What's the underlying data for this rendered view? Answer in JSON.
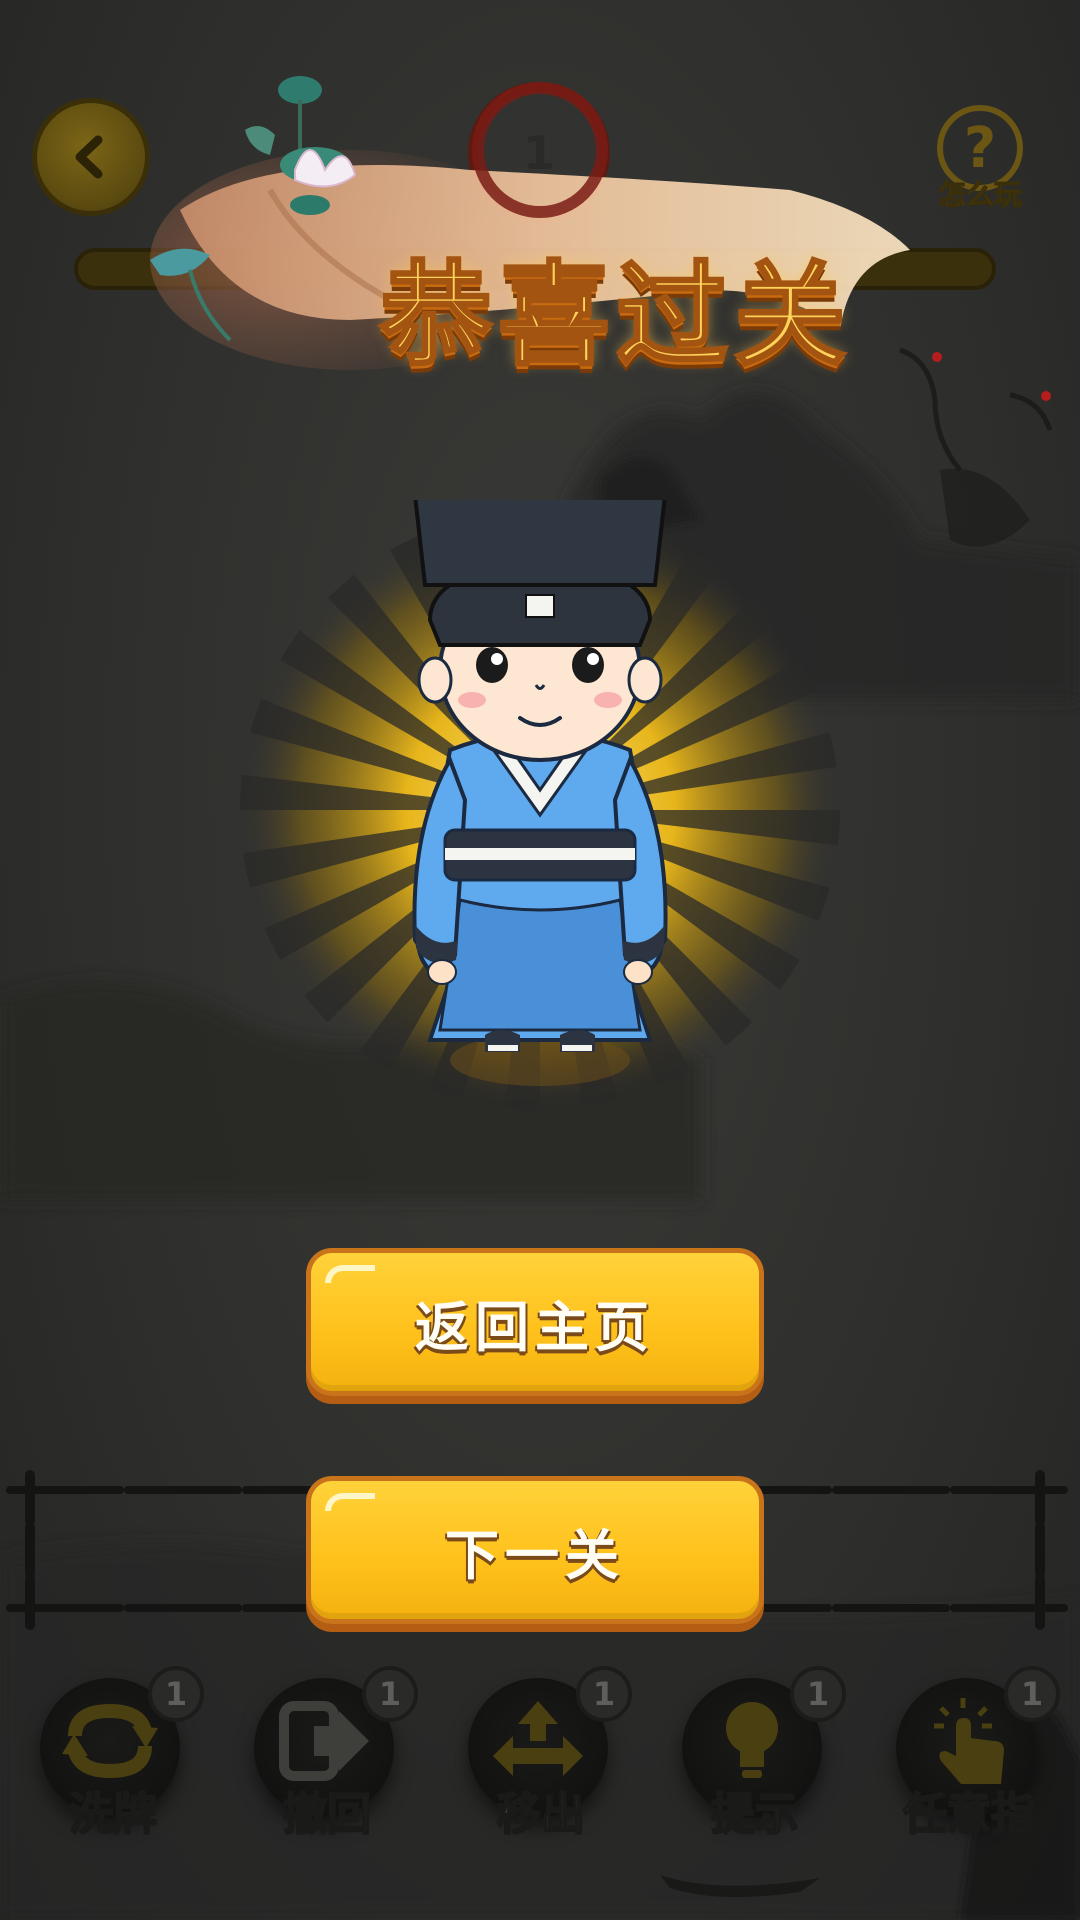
{
  "header": {
    "level_number": "1",
    "help_label": "怎么玩"
  },
  "banner": {
    "title": "恭喜过关"
  },
  "actions": {
    "home_label": "返回主页",
    "next_label": "下一关"
  },
  "tools": [
    {
      "label": "洗牌",
      "count": "1",
      "icon": "shuffle-icon"
    },
    {
      "label": "撤回",
      "count": "1",
      "icon": "undo-icon"
    },
    {
      "label": "移出",
      "count": "1",
      "icon": "move-out-icon"
    },
    {
      "label": "提示",
      "count": "1",
      "icon": "lightbulb-icon"
    },
    {
      "label": "任意指",
      "count": "1",
      "icon": "pointer-hand-icon"
    }
  ],
  "colors": {
    "button_yellow": "#ffc21c",
    "button_border": "#c9741b",
    "title_gold": "#ffd25a",
    "robe_blue": "#5fa9ef"
  }
}
